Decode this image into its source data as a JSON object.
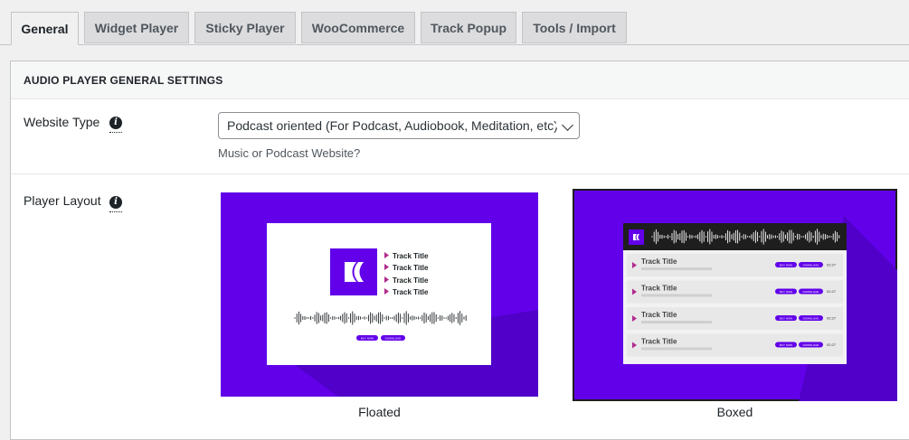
{
  "tabs": [
    {
      "label": "General",
      "active": true
    },
    {
      "label": "Widget Player",
      "active": false
    },
    {
      "label": "Sticky Player",
      "active": false
    },
    {
      "label": "WooCommerce",
      "active": false
    },
    {
      "label": "Track Popup",
      "active": false
    },
    {
      "label": "Tools / Import",
      "active": false
    }
  ],
  "section": {
    "title": "AUDIO PLAYER GENERAL SETTINGS"
  },
  "website_type": {
    "label": "Website Type",
    "info_icon": "info-icon",
    "selected": "Podcast oriented (For Podcast, Audiobook, Meditation, etc)",
    "description": "Music or Podcast Website?"
  },
  "player_layout": {
    "label": "Player Layout",
    "info_icon": "info-icon",
    "selected": "Boxed",
    "options": [
      {
        "caption": "Floated",
        "tracks": [
          "Track Title",
          "Track Title",
          "Track Title",
          "Track Title"
        ],
        "buttons": [
          "BUY NOW",
          "DOWNLOAD"
        ]
      },
      {
        "caption": "Boxed",
        "tracks": [
          "Track Title",
          "Track Title",
          "Track Title",
          "Track Title"
        ],
        "buttons": [
          "BUY NOW",
          "DOWNLOAD"
        ],
        "duration": "02:27"
      }
    ]
  },
  "colors": {
    "purple": "#6200ea",
    "purple_dark": "#5000c8",
    "bar_accent": "#b02a8e",
    "header_dark": "#1e1e1e"
  }
}
